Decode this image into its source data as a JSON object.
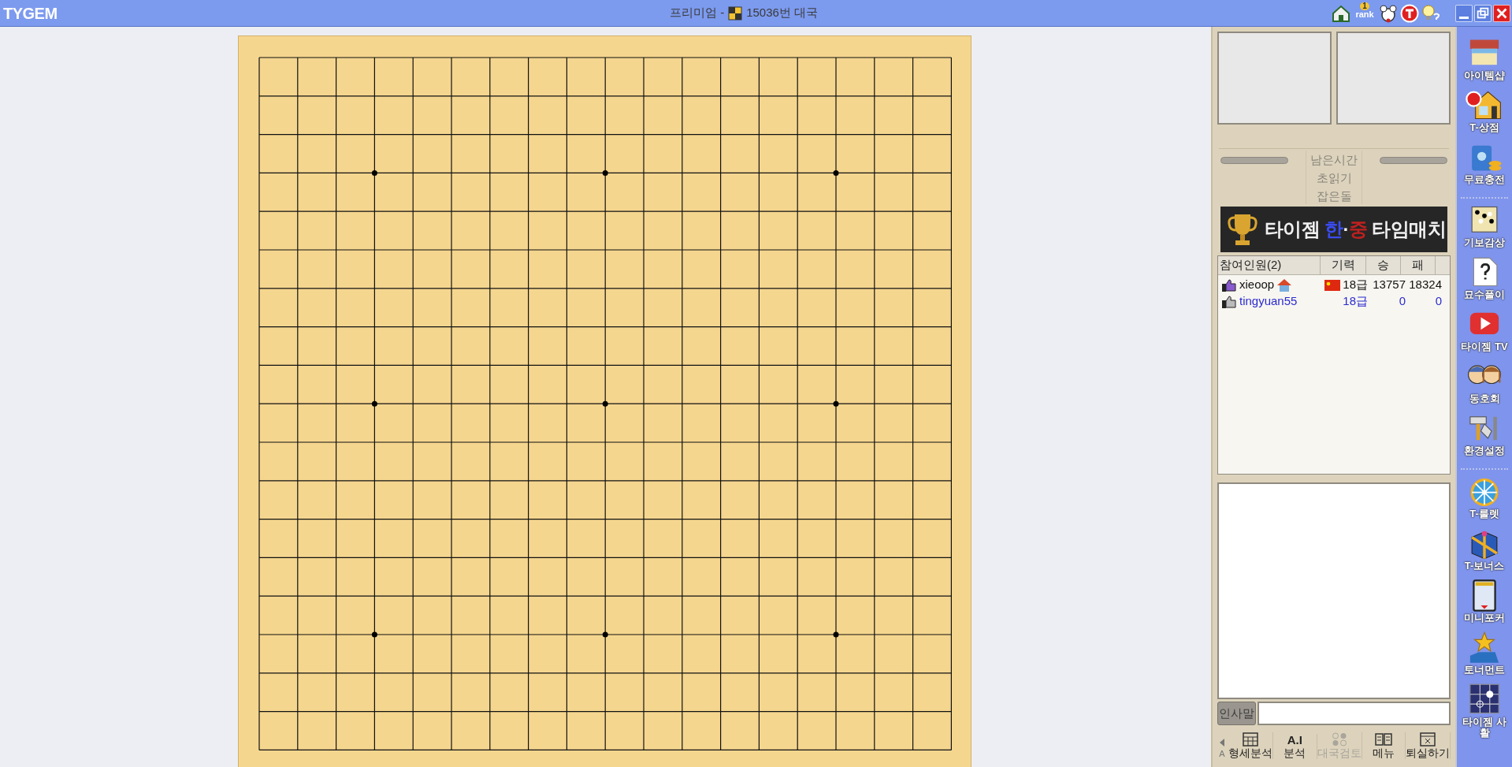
{
  "window": {
    "logo": "TYGEM",
    "title_prefix": "프리미엄 -",
    "title": "15036번 대국"
  },
  "title_tools": [
    {
      "kind": "home"
    },
    {
      "kind": "rank",
      "label": "rank",
      "badge": "1"
    },
    {
      "kind": "mouse"
    },
    {
      "kind": "t-circle"
    },
    {
      "kind": "bulb"
    }
  ],
  "window_controls": [
    {
      "kind": "minimize"
    },
    {
      "kind": "restore"
    },
    {
      "kind": "close"
    }
  ],
  "game_panel": {
    "time_labels": [
      "남은시간",
      "초읽기",
      "잡은돌"
    ],
    "banner": [
      {
        "text": "타이젬",
        "color": "#f0f0f0"
      },
      {
        "text": "한",
        "color": "#3a4cf0"
      },
      {
        "text": "·",
        "color": "#f0f0f0"
      },
      {
        "text": "중",
        "color": "#c02020"
      },
      {
        "text": "타임매치",
        "color": "#f0f0f0"
      }
    ]
  },
  "participants": {
    "columns": [
      "참여인원(2)",
      "기력",
      "승",
      "패"
    ],
    "rows": [
      {
        "name": "xieoop",
        "rank": "18급",
        "wins": "13757",
        "losses": "18324",
        "color": "#111111",
        "country_flag": true,
        "home": true
      },
      {
        "name": "tingyuan55",
        "rank": "18급",
        "wins": "0",
        "losses": "0",
        "color": "#2b2bd0",
        "country_flag": false,
        "home": false
      }
    ]
  },
  "chat": {
    "greeting_button": "인사말"
  },
  "toolbar": [
    {
      "kind": "grid",
      "label": "형세분석",
      "disabled": false
    },
    {
      "kind": "ai",
      "icon_text": "A.I",
      "label": "분석",
      "disabled": false
    },
    {
      "kind": "stones",
      "label": "대국검토",
      "disabled": true
    },
    {
      "kind": "book",
      "label": "메뉴",
      "disabled": false
    },
    {
      "kind": "exit",
      "label": "퇴실하기",
      "disabled": false
    }
  ],
  "toolbar_side": {
    "font_key": "A"
  },
  "sidebar": [
    {
      "kind": "shop",
      "label": "아이템샵"
    },
    {
      "kind": "store",
      "label": "T-상점"
    },
    {
      "kind": "battery",
      "label": "무료충전"
    },
    {
      "kind": "separator"
    },
    {
      "kind": "board",
      "label": "기보감상"
    },
    {
      "kind": "question",
      "label": "묘수풀이"
    },
    {
      "kind": "play",
      "label": "타이젬 TV"
    },
    {
      "kind": "people",
      "label": "동호회"
    },
    {
      "kind": "tools",
      "label": "환경설정"
    },
    {
      "kind": "separator"
    },
    {
      "kind": "wheel",
      "label": "T-룰렛"
    },
    {
      "kind": "gift",
      "label": "T-보너스"
    },
    {
      "kind": "card",
      "label": "미니포커"
    },
    {
      "kind": "star",
      "label": "토너먼트"
    },
    {
      "kind": "goboard",
      "label": "타이젬 사활"
    }
  ]
}
